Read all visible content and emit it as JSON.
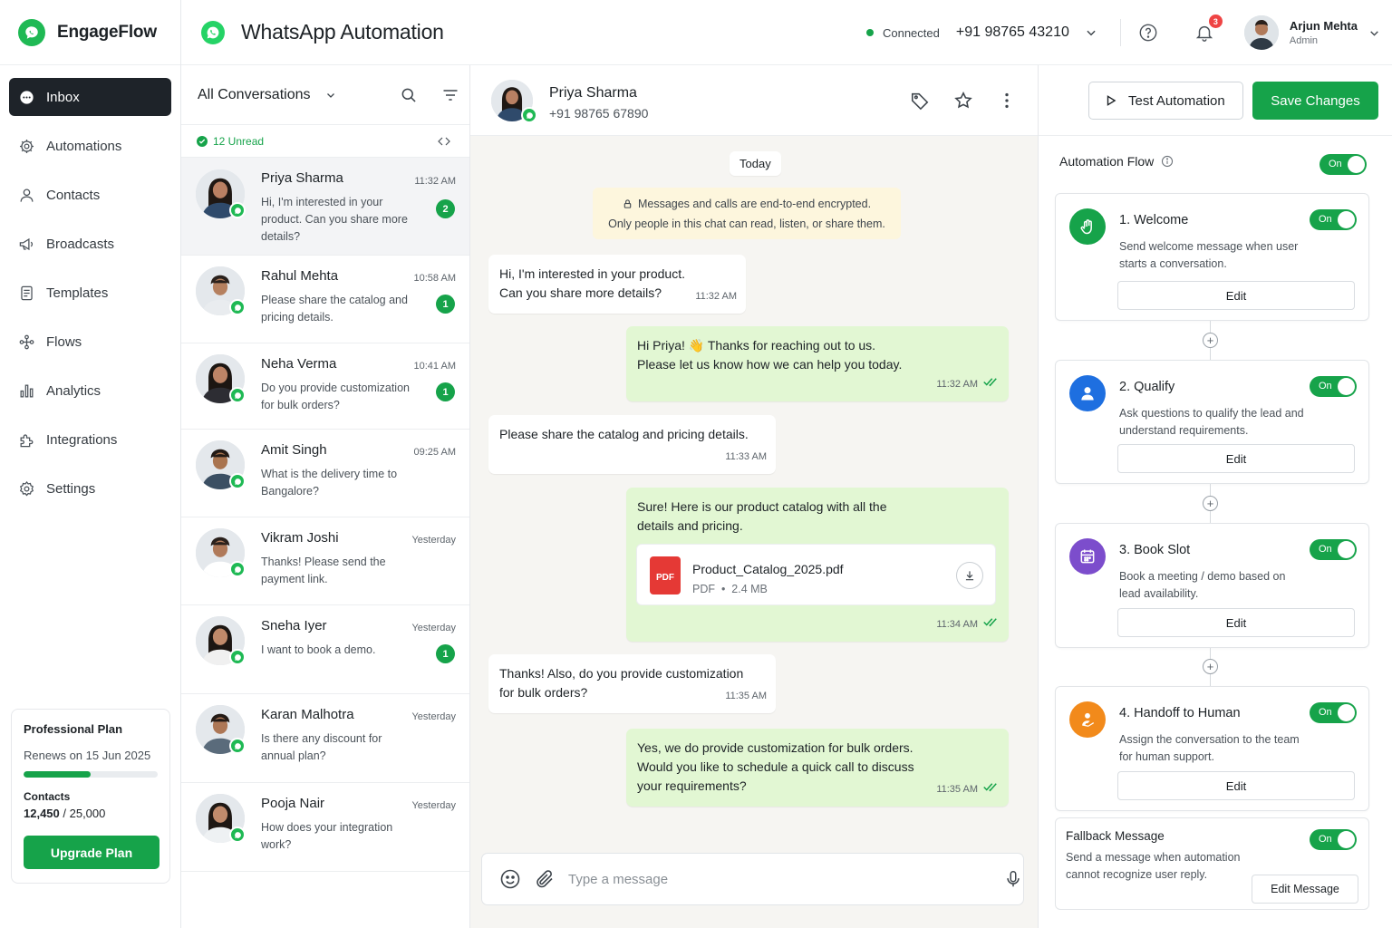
{
  "brand": {
    "name": "EngageFlow",
    "accent": "#16a34a"
  },
  "sidebar": {
    "items": [
      {
        "label": "Inbox",
        "icon": "chat-icon",
        "active": true
      },
      {
        "label": "Automations",
        "icon": "gear-icon"
      },
      {
        "label": "Contacts",
        "icon": "user-icon"
      },
      {
        "label": "Broadcasts",
        "icon": "megaphone-icon"
      },
      {
        "label": "Templates",
        "icon": "document-icon"
      },
      {
        "label": "Flows",
        "icon": "flow-icon"
      },
      {
        "label": "Analytics",
        "icon": "bar-chart-icon"
      },
      {
        "label": "Integrations",
        "icon": "puzzle-icon"
      },
      {
        "label": "Settings",
        "icon": "gear-icon"
      }
    ],
    "plan": {
      "title": "Professional Plan",
      "renews": "Renews on 15 Jun 2025",
      "usage_fraction": 0.5,
      "contacts_label": "Contacts",
      "contacts_used": "12,450",
      "contacts_sep": " / ",
      "contacts_total": "25,000",
      "upgrade_label": "Upgrade Plan"
    }
  },
  "header": {
    "title": "WhatsApp Automation",
    "status": "Connected",
    "phone": "+91 98765 43210",
    "notification_count": "3",
    "user_name": "Arjun Mehta",
    "user_role": "Admin"
  },
  "conversations": {
    "filter_label": "All Conversations",
    "unread_label": "12 Unread",
    "items": [
      {
        "name": "Priya Sharma",
        "time": "11:32 AM",
        "preview": "Hi, I'm interested in your product. Can you share more details?",
        "unread": "2",
        "selected": true
      },
      {
        "name": "Rahul Mehta",
        "time": "10:58 AM",
        "preview": "Please share the catalog and pricing details.",
        "unread": "1"
      },
      {
        "name": "Neha Verma",
        "time": "10:41 AM",
        "preview": "Do you provide customization for bulk orders?",
        "unread": "1"
      },
      {
        "name": "Amit Singh",
        "time": "09:25 AM",
        "preview": "What is the delivery time to Bangalore?",
        "unread": ""
      },
      {
        "name": "Vikram Joshi",
        "time": "Yesterday",
        "preview": "Thanks! Please send the payment link.",
        "unread": ""
      },
      {
        "name": "Sneha Iyer",
        "time": "Yesterday",
        "preview": "I want to book a demo.",
        "unread": "1"
      },
      {
        "name": "Karan Malhotra",
        "time": "Yesterday",
        "preview": "Is there any discount for annual plan?",
        "unread": ""
      },
      {
        "name": "Pooja Nair",
        "time": "Yesterday",
        "preview": "How does your integration work?",
        "unread": ""
      }
    ]
  },
  "chat": {
    "contact_name": "Priya Sharma",
    "contact_phone": "+91 98765 67890",
    "day_label": "Today",
    "encryption_line1": "Messages and calls are end-to-end encrypted.",
    "encryption_line2": "Only people in this chat can read, listen, or share them.",
    "messages": [
      {
        "dir": "in",
        "lines": [
          "Hi, I'm interested in your product.",
          "Can you share more details?"
        ],
        "time": "11:32 AM"
      },
      {
        "dir": "out",
        "lines": [
          "Hi Priya! 👋  Thanks for reaching out to us.",
          "Please let us know how we can help you today."
        ],
        "time": "11:32 AM"
      },
      {
        "dir": "in",
        "lines": [
          "Please share the catalog and pricing details."
        ],
        "time": "11:33 AM"
      },
      {
        "dir": "out",
        "lines": [
          "Sure! Here is our product catalog with all the",
          "details and pricing."
        ],
        "time": "11:34 AM",
        "attachment": {
          "name": "Product_Catalog_2025.pdf",
          "type": "PDF",
          "size": "2.4 MB",
          "icon_label": "PDF"
        }
      },
      {
        "dir": "in",
        "lines": [
          "Thanks! Also, do you provide customization",
          "for bulk orders?"
        ],
        "time": "11:35 AM"
      },
      {
        "dir": "out",
        "lines": [
          "Yes, we do provide customization for bulk orders.",
          "Would you like to schedule a quick call to discuss",
          "your requirements?"
        ],
        "time": "11:35 AM"
      }
    ],
    "composer_placeholder": "Type a message"
  },
  "automation": {
    "test_label": "Test Automation",
    "save_label": "Save Changes",
    "flow_title": "Automation Flow",
    "flow_toggle": "On",
    "steps": [
      {
        "title": "1. Welcome",
        "desc": "Send welcome message when user starts a conversation.",
        "toggle": "On",
        "edit": "Edit",
        "color": "#16a34a",
        "icon": "wave-hand-icon"
      },
      {
        "title": "2. Qualify",
        "desc": "Ask questions to qualify the lead and understand requirements.",
        "toggle": "On",
        "edit": "Edit",
        "color": "#1e6fe0",
        "icon": "user-icon"
      },
      {
        "title": "3. Book Slot",
        "desc": "Book a meeting / demo based on lead availability.",
        "toggle": "On",
        "edit": "Edit",
        "color": "#7c4dcc",
        "icon": "calendar-icon"
      },
      {
        "title": "4. Handoff to Human",
        "desc": "Assign the conversation to the team for human support.",
        "toggle": "On",
        "edit": "Edit",
        "color": "#f28a1b",
        "icon": "handoff-icon"
      }
    ],
    "fallback": {
      "title": "Fallback Message",
      "desc": "Send a message when automation cannot recognize user reply.",
      "toggle": "On",
      "edit": "Edit Message"
    }
  }
}
